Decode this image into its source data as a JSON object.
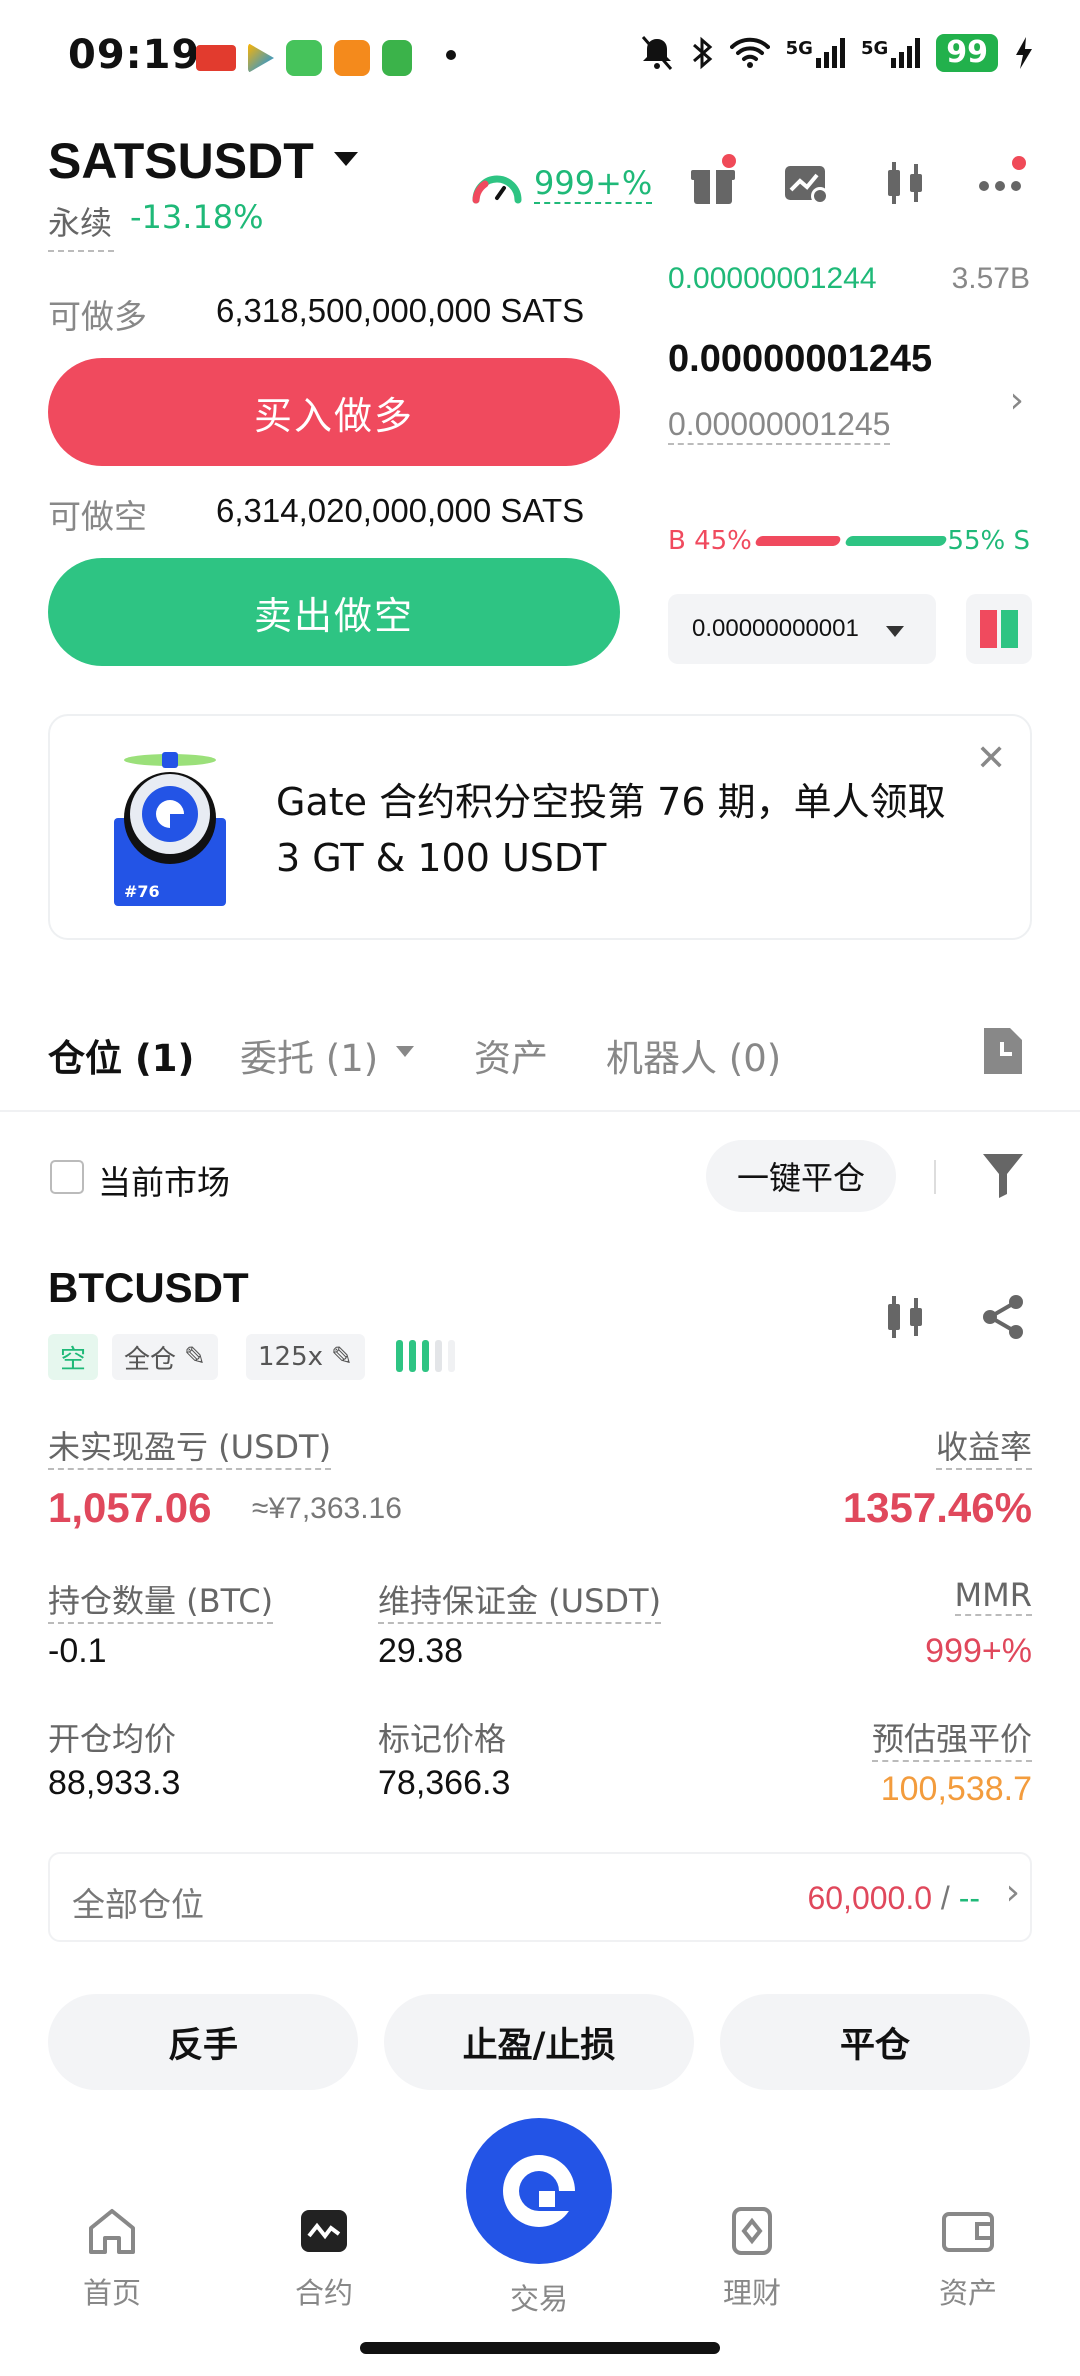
{
  "status_bar": {
    "time": "09:19",
    "battery": "99",
    "network_labels": [
      "5G",
      "5G"
    ]
  },
  "header": {
    "pair": "SATSUSDT",
    "contract_type": "永续",
    "change_24h": "-13.18%",
    "risk_ratio": "999+%"
  },
  "order_panel": {
    "long_available_label": "可做多",
    "long_available_value": "6,318,500,000,000 SATS",
    "buy_button": "买入做多",
    "short_available_label": "可做空",
    "short_available_value": "6,314,020,000,000 SATS",
    "sell_button": "卖出做空"
  },
  "order_book": {
    "bid_price": "0.00000001244",
    "bid_qty": "3.57B",
    "last_price": "0.00000001245",
    "mark_price": "0.00000001245",
    "buy_ratio_label": "B 45%",
    "sell_ratio_label": "55% S",
    "buy_ratio": 45,
    "sell_ratio": 55,
    "precision": "0.00000000001"
  },
  "banner": {
    "text": "Gate 合约积分空投第 76 期，单人领取 3 GT & 100 USDT",
    "badge": "#76"
  },
  "tabs": [
    {
      "label": "仓位 (1)",
      "active": true
    },
    {
      "label": "委托 (1)",
      "active": false
    },
    {
      "label": "资产",
      "active": false
    },
    {
      "label": "机器人 (0)",
      "active": false
    }
  ],
  "filter": {
    "current_market_label": "当前市场",
    "close_all_button": "一键平仓"
  },
  "position": {
    "symbol": "BTCUSDT",
    "side_tag": "空",
    "margin_mode_tag": "全仓",
    "leverage_tag": "125x",
    "unrealized_pnl_label": "未实现盈亏 (USDT)",
    "unrealized_pnl": "1,057.06",
    "unrealized_pnl_cny": "≈¥7,363.16",
    "roe_label": "收益率",
    "roe": "1357.46%",
    "size_label": "持仓数量 (BTC)",
    "size": "-0.1",
    "maint_margin_label": "维持保证金 (USDT)",
    "maint_margin": "29.38",
    "mmr_label": "MMR",
    "mmr": "999+%",
    "entry_price_label": "开仓均价",
    "entry_price": "88,933.3",
    "mark_price_label": "标记价格",
    "mark_price": "78,366.3",
    "liq_price_label": "预估强平价",
    "liq_price": "100,538.7",
    "all_positions_label": "全部仓位",
    "all_positions_value": "60,000.0",
    "all_positions_sep": "/",
    "all_positions_tpsl": "--"
  },
  "actions": {
    "reverse": "反手",
    "tp_sl": "止盈/止损",
    "close": "平仓"
  },
  "bottom_nav": [
    {
      "label": "首页",
      "icon": "home-icon"
    },
    {
      "label": "合约",
      "icon": "futures-icon"
    },
    {
      "label": "交易",
      "icon": "trade-icon"
    },
    {
      "label": "理财",
      "icon": "earn-icon"
    },
    {
      "label": "资产",
      "icon": "wallet-icon"
    }
  ],
  "colors": {
    "red": "#f04a5e",
    "green": "#2ec483",
    "brand_blue": "#2354e6",
    "liq_orange": "#f39c3d"
  }
}
